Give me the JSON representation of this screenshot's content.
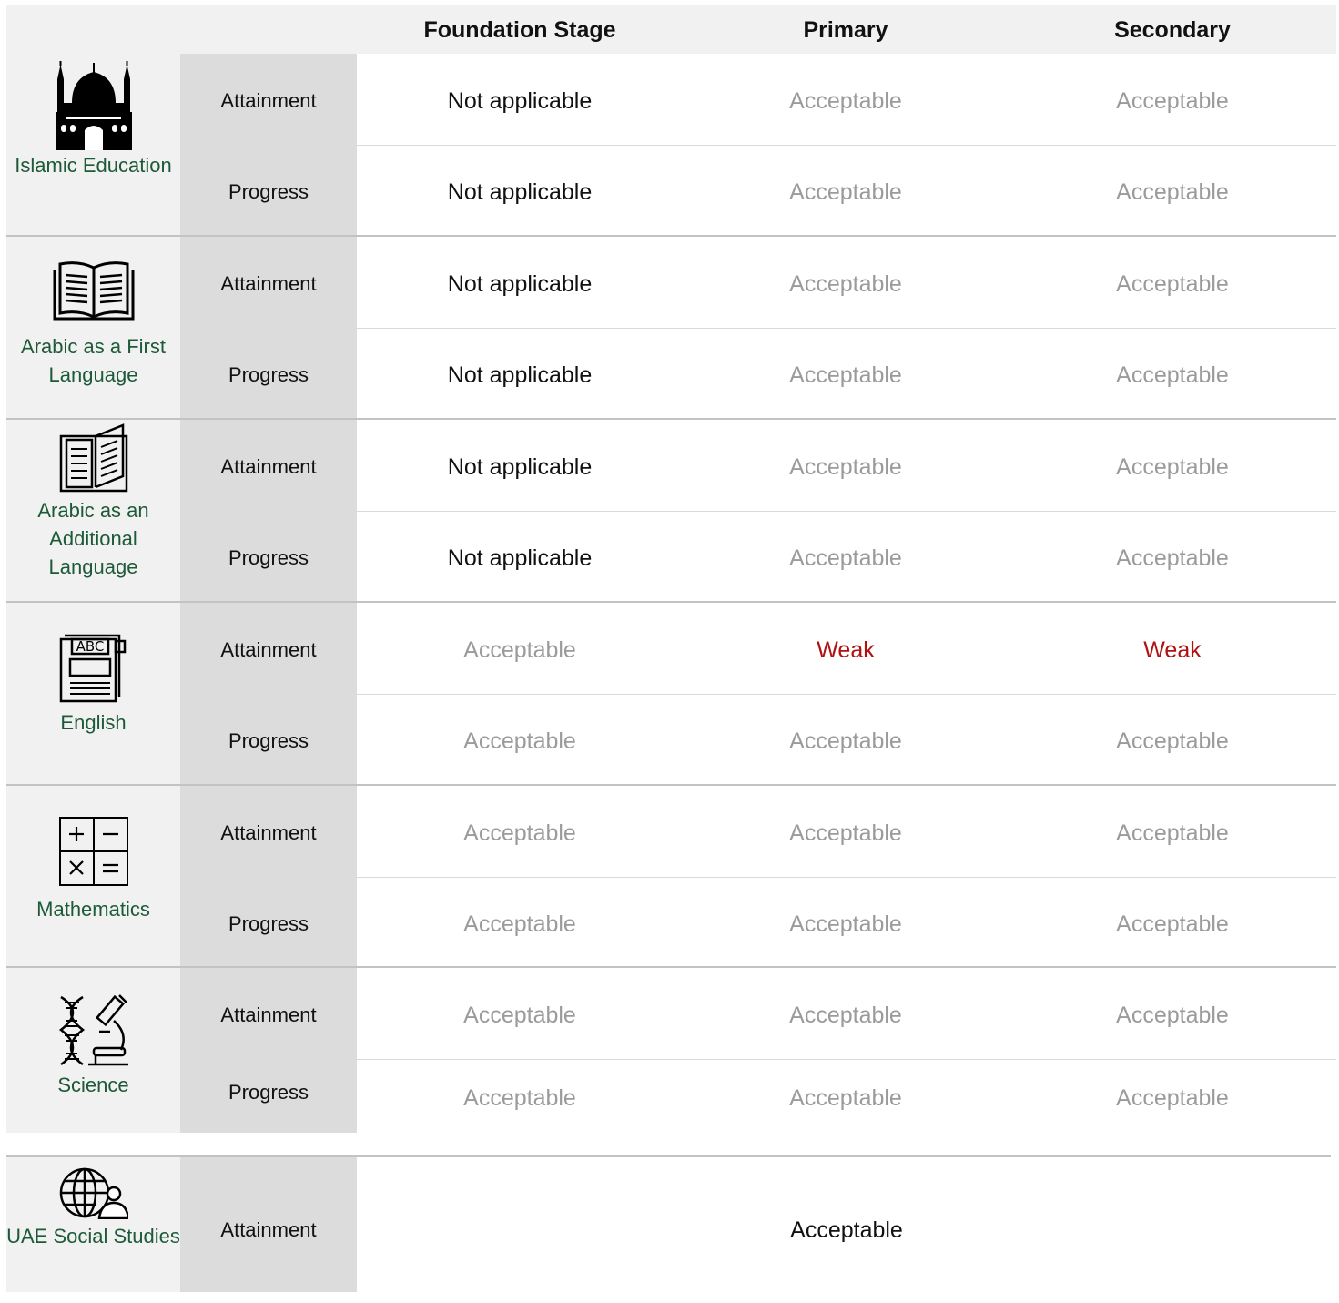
{
  "header": {
    "foundation_stage": "Foundation Stage",
    "primary": "Primary",
    "secondary": "Secondary"
  },
  "subjects": [
    {
      "name": "Islamic Education",
      "icon": "mosque-icon",
      "rows": [
        {
          "metric": "Attainment",
          "foundation_stage": "Not applicable",
          "primary": "Acceptable",
          "secondary": "Acceptable"
        },
        {
          "metric": "Progress",
          "foundation_stage": "Not applicable",
          "primary": "Acceptable",
          "secondary": "Acceptable"
        }
      ]
    },
    {
      "name": "Arabic as a First Language",
      "icon": "open-book-icon",
      "rows": [
        {
          "metric": "Attainment",
          "foundation_stage": "Not applicable",
          "primary": "Acceptable",
          "secondary": "Acceptable"
        },
        {
          "metric": "Progress",
          "foundation_stage": "Not applicable",
          "primary": "Acceptable",
          "secondary": "Acceptable"
        }
      ]
    },
    {
      "name": "Arabic as an Additional Language",
      "icon": "book-outline-icon",
      "rows": [
        {
          "metric": "Attainment",
          "foundation_stage": "Not applicable",
          "primary": "Acceptable",
          "secondary": "Acceptable"
        },
        {
          "metric": "Progress",
          "foundation_stage": "Not applicable",
          "primary": "Acceptable",
          "secondary": "Acceptable"
        }
      ]
    },
    {
      "name": "English",
      "icon": "abc-book-icon",
      "rows": [
        {
          "metric": "Attainment",
          "foundation_stage": "Acceptable",
          "primary": "Weak",
          "secondary": "Weak"
        },
        {
          "metric": "Progress",
          "foundation_stage": "Acceptable",
          "primary": "Acceptable",
          "secondary": "Acceptable"
        }
      ]
    },
    {
      "name": "Mathematics",
      "icon": "math-operators-icon",
      "rows": [
        {
          "metric": "Attainment",
          "foundation_stage": "Acceptable",
          "primary": "Acceptable",
          "secondary": "Acceptable"
        },
        {
          "metric": "Progress",
          "foundation_stage": "Acceptable",
          "primary": "Acceptable",
          "secondary": "Acceptable"
        }
      ]
    },
    {
      "name": "Science",
      "icon": "dna-microscope-icon",
      "rows": [
        {
          "metric": "Attainment",
          "foundation_stage": "Acceptable",
          "primary": "Acceptable",
          "secondary": "Acceptable"
        },
        {
          "metric": "Progress",
          "foundation_stage": "Acceptable",
          "primary": "Acceptable",
          "secondary": "Acceptable"
        }
      ]
    }
  ],
  "social_studies": {
    "name": "UAE Social Studies",
    "icon": "globe-person-icon",
    "metric": "Attainment",
    "value": "Acceptable"
  },
  "colors": {
    "subject_text": "#1d5a38",
    "grade_acceptable": "#9b9b9b",
    "grade_weak": "#b01010",
    "grade_not_applicable": "#111111"
  }
}
